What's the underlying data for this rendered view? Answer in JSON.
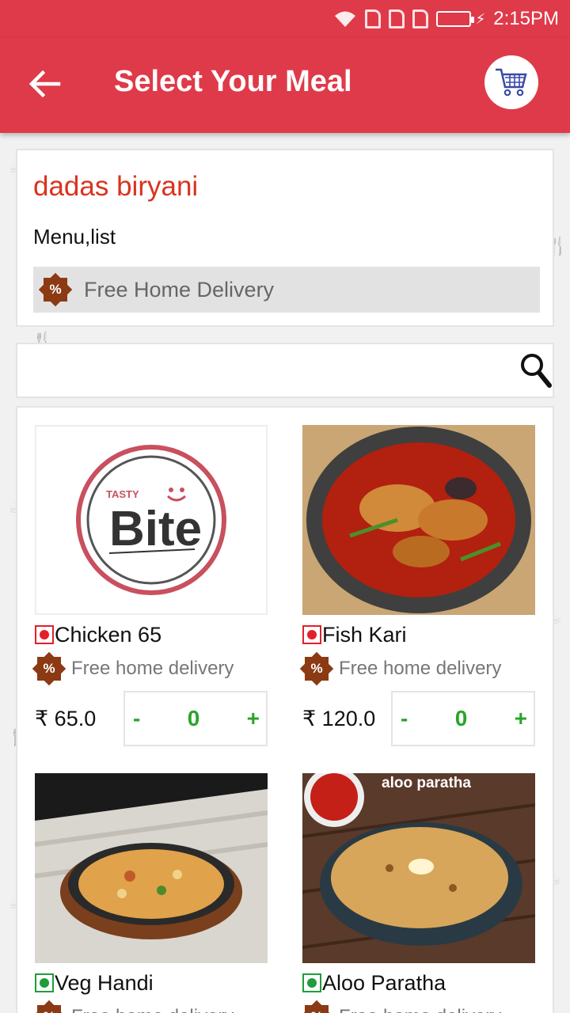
{
  "status_bar": {
    "time": "2:15PM"
  },
  "app_bar": {
    "title": "Select Your Meal"
  },
  "restaurant": {
    "name": "dadas biryani",
    "subtitle": "Menu,list",
    "offer": "Free Home Delivery"
  },
  "search": {
    "value": "",
    "placeholder": ""
  },
  "items": [
    {
      "name": "Chicken 65",
      "delivery": "Free home delivery",
      "price": "₹ 65.0",
      "qty": "0",
      "minus": "-",
      "plus": "+",
      "type": "non-veg",
      "image": "tasty-bite-logo"
    },
    {
      "name": "Fish Kari",
      "delivery": "Free home delivery",
      "price": "₹ 120.0",
      "qty": "0",
      "minus": "-",
      "plus": "+",
      "type": "non-veg",
      "image": "fish-curry-photo"
    },
    {
      "name": "Veg Handi",
      "delivery": "Free home delivery",
      "price": "",
      "qty": "",
      "type": "veg",
      "image": "veg-handi-photo"
    },
    {
      "name": "Aloo Paratha",
      "delivery": "Free home delivery",
      "price": "",
      "qty": "",
      "type": "veg",
      "image": "aloo-paratha-photo",
      "image_caption": "aloo paratha"
    }
  ],
  "logo": {
    "text_small": "TASTY",
    "text_big": "Bite"
  },
  "colors": {
    "primary": "#df3a49",
    "accent_text": "#d9331f",
    "stepper_green": "#2aa52a",
    "non_veg": "#e3202a",
    "veg": "#1f9d3a",
    "offer_badge": "#8b3a14"
  }
}
